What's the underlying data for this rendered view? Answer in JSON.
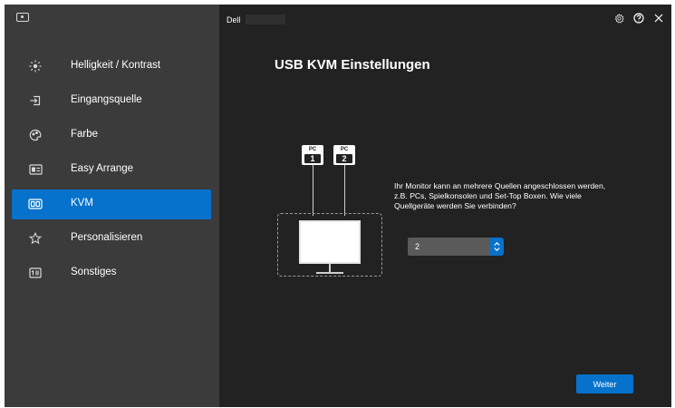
{
  "window": {
    "brand": "Dell"
  },
  "sidebar": {
    "items": [
      {
        "label": "Helligkeit / Kontrast",
        "icon": "brightness-icon",
        "active": false
      },
      {
        "label": "Eingangsquelle",
        "icon": "input-source-icon",
        "active": false
      },
      {
        "label": "Farbe",
        "icon": "color-palette-icon",
        "active": false
      },
      {
        "label": "Easy Arrange",
        "icon": "easy-arrange-icon",
        "active": false
      },
      {
        "label": "KVM",
        "icon": "kvm-icon",
        "active": true
      },
      {
        "label": "Personalisieren",
        "icon": "star-icon",
        "active": false
      },
      {
        "label": "Sonstiges",
        "icon": "others-icon",
        "active": false
      }
    ]
  },
  "main": {
    "title": "USB KVM Einstellungen",
    "diagram": {
      "pc1": {
        "label": "PC",
        "number": "1"
      },
      "pc2": {
        "label": "PC",
        "number": "2"
      }
    },
    "description": "Ihr Monitor kann an mehrere Quellen angeschlossen werden, z.B. PCs, Spielkonsolen und Set-Top Boxen. Wie viele Quellgeräte werden Sie verbinden?",
    "source_count": {
      "value": "2"
    },
    "next_label": "Weiter"
  },
  "colors": {
    "accent": "#0672cb",
    "sidebar_bg": "#3b3b3b",
    "main_bg": "#222222"
  }
}
